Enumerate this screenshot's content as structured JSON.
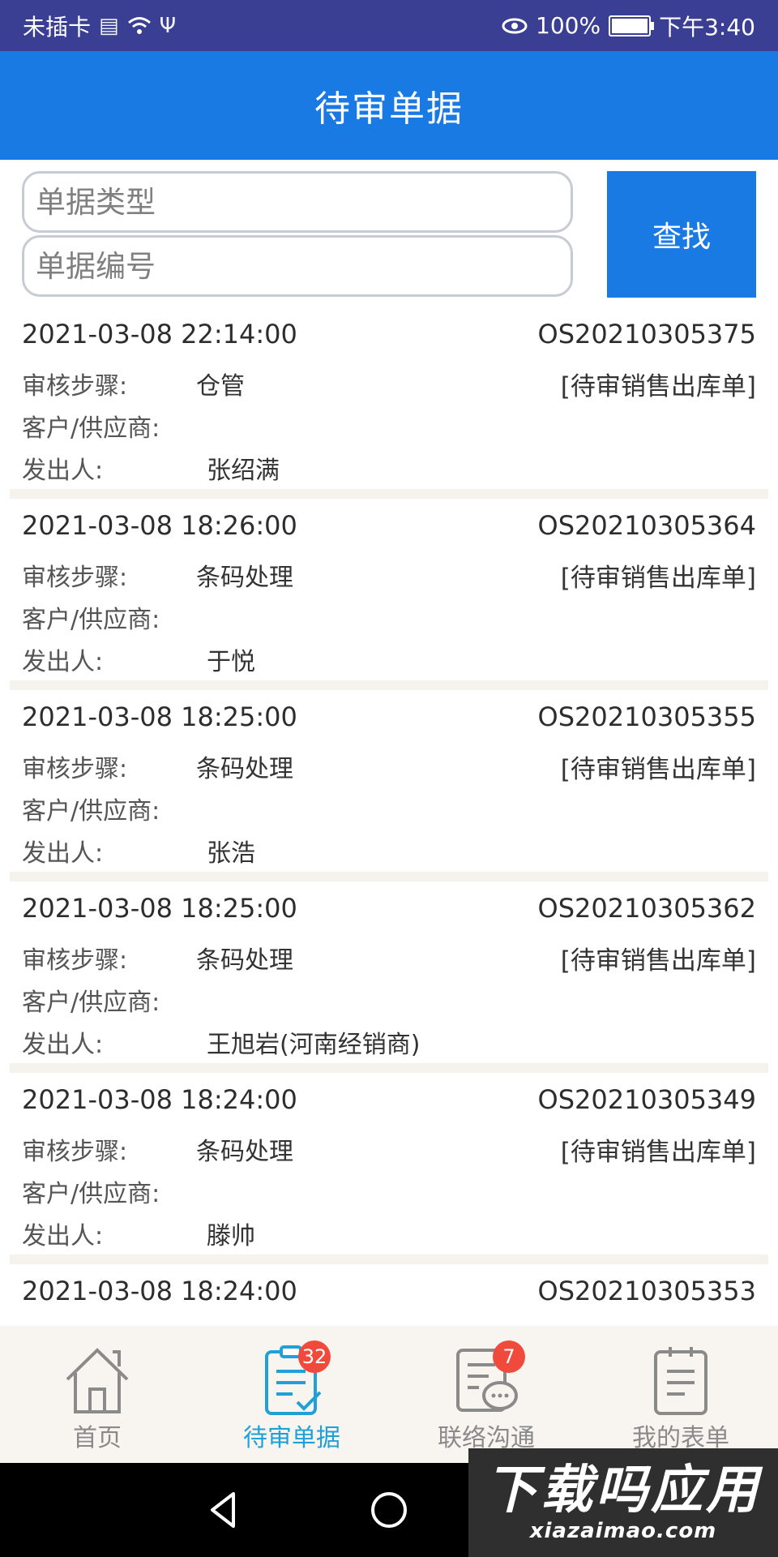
{
  "status_bar": {
    "carrier": "未插卡",
    "battery": "100%",
    "time": "下午3:40"
  },
  "header": {
    "title": "待审单据"
  },
  "search": {
    "type_placeholder": "单据类型",
    "number_placeholder": "单据编号",
    "button": "查找"
  },
  "labels": {
    "step": "审核步骤:",
    "customer": "客户/供应商:",
    "sender": "发出人:"
  },
  "records": [
    {
      "datetime": "2021-03-08 22:14:00",
      "number": "OS20210305375",
      "step": "仓管",
      "type": "[待审销售出库单]",
      "customer": "",
      "sender": "张绍满"
    },
    {
      "datetime": "2021-03-08 18:26:00",
      "number": "OS20210305364",
      "step": "条码处理",
      "type": "[待审销售出库单]",
      "customer": "",
      "sender": "于悦"
    },
    {
      "datetime": "2021-03-08 18:25:00",
      "number": "OS20210305355",
      "step": "条码处理",
      "type": "[待审销售出库单]",
      "customer": "",
      "sender": "张浩"
    },
    {
      "datetime": "2021-03-08 18:25:00",
      "number": "OS20210305362",
      "step": "条码处理",
      "type": "[待审销售出库单]",
      "customer": "",
      "sender": "王旭岩(河南经销商)"
    },
    {
      "datetime": "2021-03-08 18:24:00",
      "number": "OS20210305349",
      "step": "条码处理",
      "type": "[待审销售出库单]",
      "customer": "",
      "sender": "滕帅"
    },
    {
      "datetime": "2021-03-08 18:24:00",
      "number": "OS20210305353",
      "step": "",
      "type": "",
      "customer": "",
      "sender": ""
    }
  ],
  "tabs": [
    {
      "label": "首页",
      "icon": "home-icon"
    },
    {
      "label": "待审单据",
      "icon": "clipboard-check-icon",
      "badge": "32"
    },
    {
      "label": "联络沟通",
      "icon": "message-icon",
      "badge": "7"
    },
    {
      "label": "我的表单",
      "icon": "form-list-icon"
    }
  ],
  "watermark": {
    "main": "下载吗应用",
    "url": "xiazaimao.com"
  },
  "colors": {
    "header": "#1a7ae4",
    "statusbar": "#3a3f93",
    "active_tab": "#21a0d8",
    "badge": "#f04a3c"
  }
}
